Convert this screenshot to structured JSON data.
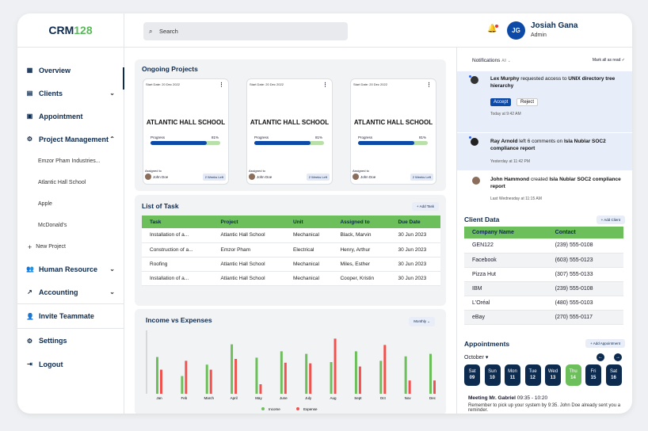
{
  "brand": {
    "prefix": "CRM",
    "suffix": "128"
  },
  "search": {
    "placeholder": "Search"
  },
  "user": {
    "initials": "JG",
    "name": "Josiah Gana",
    "role": "Admin"
  },
  "sidebar": {
    "overview": "Overview",
    "clients": "Clients",
    "appointment": "Appointment",
    "project_management": "Project Management",
    "projects": [
      "Emzor Pham Industries...",
      "Atlantic Hall School",
      "Apple",
      "McDonald's"
    ],
    "new_project": "New Project",
    "human_resource": "Human Resource",
    "accounting": "Accounting",
    "invite": "Invite Teammate",
    "settings": "Settings",
    "logout": "Logout"
  },
  "ongoing": {
    "title": "Ongoing Projects",
    "cards": [
      {
        "start": "Start Date: 20 Dec 2022",
        "name": "ATLANTIC HALL SCHOOL",
        "progress_label": "Progress",
        "progress": "81%",
        "progress_value": 0.81,
        "assigned_label": "Assigned to",
        "assignee": "John Doe",
        "due": "2 Weeks Left"
      },
      {
        "start": "Start Date: 20 Dec 2022",
        "name": "ATLANTIC HALL SCHOOL",
        "progress_label": "Progress",
        "progress": "81%",
        "progress_value": 0.81,
        "assigned_label": "Assigned to",
        "assignee": "John Doe",
        "due": "2 Weeks Left"
      },
      {
        "start": "Start Date: 20 Dec 2022",
        "name": "ATLANTIC HALL SCHOOL",
        "progress_label": "Progress",
        "progress": "81%",
        "progress_value": 0.81,
        "assigned_label": "Assigned to",
        "assignee": "John Doe",
        "due": "2 Weeks Left"
      }
    ]
  },
  "tasks": {
    "title": "List of Task",
    "add": "Add Task",
    "headers": [
      "Task",
      "Project",
      "Unit",
      "Assigned to",
      "Due Date"
    ],
    "rows": [
      [
        "Installation of a...",
        "Atlantic Hall School",
        "Mechanical",
        "Black, Marvin",
        "30 Jun 2023"
      ],
      [
        "Construction of a...",
        "Emzor Pham",
        "Electrical",
        "Henry, Arthur",
        "30 Jun 2023"
      ],
      [
        "Roofing",
        "Atlantic Hall School",
        "Mechanical",
        "Miles, Esther",
        "30 Jun 2023"
      ],
      [
        "Installation of a...",
        "Atlantic Hall School",
        "Mechanical",
        "Cooper, Kristin",
        "30 Jun 2023"
      ]
    ]
  },
  "chart_data": {
    "type": "bar",
    "title": "Income vs Expenses",
    "period": "Monthly",
    "categories": [
      "Jan",
      "Feb",
      "March",
      "April",
      "May",
      "June",
      "July",
      "Aug",
      "Sept",
      "Oct",
      "Nov",
      "Dec"
    ],
    "series": [
      {
        "name": "Income",
        "color": "#6dbf5b",
        "values": [
          58,
          28,
          46,
          78,
          57,
          67,
          63,
          50,
          67,
          52,
          59,
          63
        ]
      },
      {
        "name": "Expense",
        "color": "#ef5350",
        "values": [
          38,
          52,
          38,
          55,
          15,
          49,
          48,
          87,
          43,
          77,
          21,
          21
        ]
      }
    ],
    "ylim": [
      0,
      100
    ],
    "grid": false,
    "legend": "bottom"
  },
  "notifications": {
    "title": "Notifications",
    "filter": "All",
    "mark_all": "Mark all as read",
    "items": [
      {
        "actor": "Lex Murphy",
        "text": "requested access to",
        "target": "UNIX directory tree hierarchy",
        "accept": "Accept",
        "reject": "Reject",
        "time": "Today at 9:42 AM"
      },
      {
        "actor": "Ray Arnold",
        "text": "left 6 comments on",
        "target": "Isla Nublar SOC2 compliance report",
        "time": "Yesterday at 11:42 PM"
      },
      {
        "actor": "John Hammond",
        "text": "created",
        "target": "Isla Nublar SOC2 compliance report",
        "time": "Last Wednesday at 11:15 AM"
      }
    ]
  },
  "clients": {
    "title": "Client Data",
    "add": "Add Client",
    "headers": [
      "Company Name",
      "Contact"
    ],
    "rows": [
      [
        "GEN122",
        "(239) 555-0108"
      ],
      [
        "Facebook",
        "(603) 555-0123"
      ],
      [
        "Pizza Hut",
        "(307) 555-0133"
      ],
      [
        "IBM",
        "(239) 555-0108"
      ],
      [
        "L'Oréal",
        "(480) 555-0103"
      ],
      [
        "eBay",
        "(270) 555-0117"
      ]
    ]
  },
  "appointments": {
    "title": "Appointments",
    "add": "Add Appointment",
    "month": "October",
    "days": [
      [
        "Sat",
        "09"
      ],
      [
        "Sun",
        "10"
      ],
      [
        "Mon",
        "11"
      ],
      [
        "Tue",
        "12"
      ],
      [
        "Wed",
        "13"
      ],
      [
        "Thu",
        "14"
      ],
      [
        "Fri",
        "15"
      ],
      [
        "Sat",
        "16"
      ]
    ],
    "meeting_title": "Meeting Mr. Gabriel",
    "meeting_time": "09:35 - 10:20",
    "meeting_note": "Remember to pick up your system by 9:35. John Doe already sent you a reminder."
  }
}
